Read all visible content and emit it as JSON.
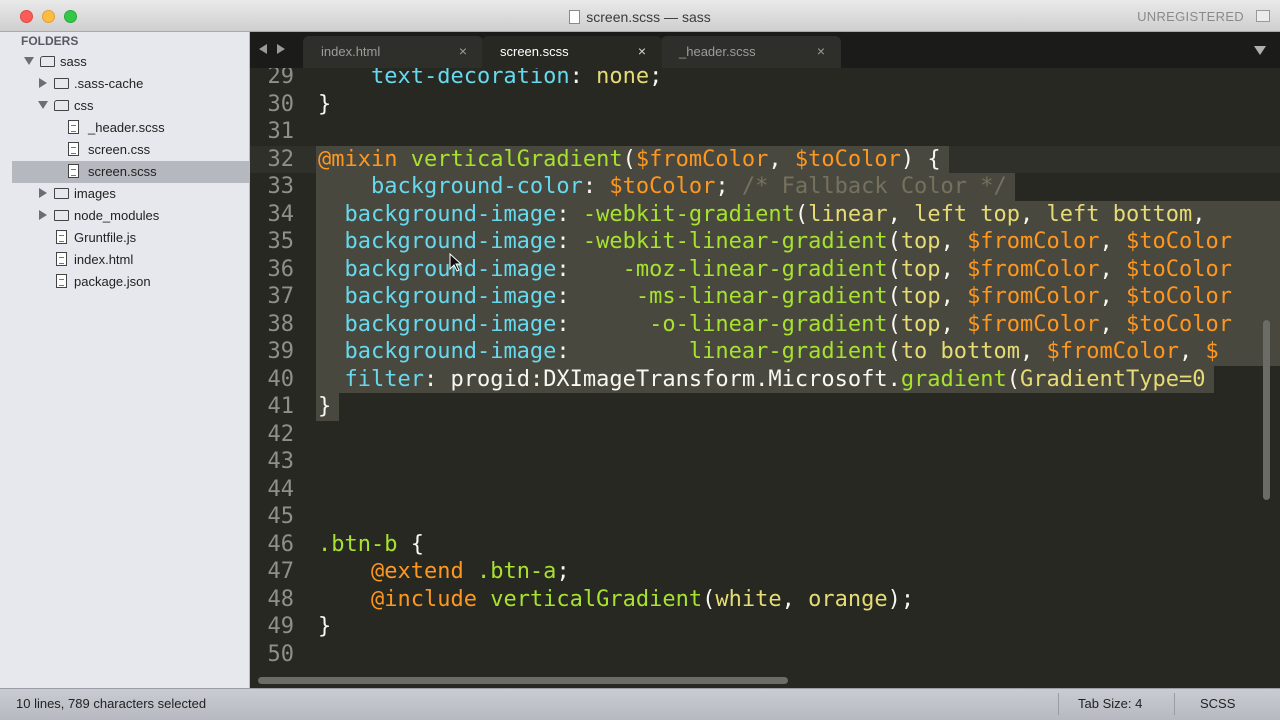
{
  "window": {
    "title": "screen.scss — sass",
    "registration": "UNREGISTERED"
  },
  "sidebar": {
    "header": "FOLDERS",
    "items": [
      {
        "label": "sass",
        "type": "folder",
        "expanded": true,
        "depth": 0
      },
      {
        "label": ".sass-cache",
        "type": "folder",
        "expanded": false,
        "depth": 1
      },
      {
        "label": "css",
        "type": "folder",
        "expanded": true,
        "depth": 1
      },
      {
        "label": "_header.scss",
        "type": "file",
        "depth": 2
      },
      {
        "label": "screen.css",
        "type": "file",
        "depth": 2
      },
      {
        "label": "screen.scss",
        "type": "file",
        "depth": 2,
        "selected": true
      },
      {
        "label": "images",
        "type": "folder",
        "expanded": false,
        "depth": 1
      },
      {
        "label": "node_modules",
        "type": "folder",
        "expanded": false,
        "depth": 1
      },
      {
        "label": "Gruntfile.js",
        "type": "file",
        "depth": 1
      },
      {
        "label": "index.html",
        "type": "file",
        "depth": 1
      },
      {
        "label": "package.json",
        "type": "file",
        "depth": 1
      }
    ]
  },
  "tabs": [
    {
      "label": "index.html",
      "close": "×",
      "active": false
    },
    {
      "label": "screen.scss",
      "close": "×",
      "active": true
    },
    {
      "label": "_header.scss",
      "close": "×",
      "active": false
    }
  ],
  "editor": {
    "lines": [
      {
        "n": "29",
        "tokens": [
          [
            "plain",
            "    "
          ],
          [
            "prop",
            "text-decoration"
          ],
          [
            "plain",
            ": "
          ],
          [
            "val",
            "none"
          ],
          [
            "plain",
            ";"
          ]
        ]
      },
      {
        "n": "30",
        "tokens": [
          [
            "plain",
            "}"
          ]
        ]
      },
      {
        "n": "31",
        "tokens": []
      },
      {
        "n": "32",
        "tokens": [
          [
            "at",
            "@mixin"
          ],
          [
            "plain",
            " "
          ],
          [
            "fn",
            "verticalGradient"
          ],
          [
            "plain",
            "("
          ],
          [
            "var",
            "$fromColor"
          ],
          [
            "plain",
            ", "
          ],
          [
            "var",
            "$toColor"
          ],
          [
            "plain",
            ") {"
          ]
        ]
      },
      {
        "n": "33",
        "tokens": [
          [
            "plain",
            "    "
          ],
          [
            "prop",
            "background-color"
          ],
          [
            "plain",
            ": "
          ],
          [
            "var",
            "$toColor"
          ],
          [
            "plain",
            "; "
          ],
          [
            "cmt",
            "/* Fallback Color */"
          ]
        ]
      },
      {
        "n": "34",
        "tokens": [
          [
            "plain",
            "  "
          ],
          [
            "prop",
            "background-image"
          ],
          [
            "plain",
            ": "
          ],
          [
            "fn",
            "-webkit-gradient"
          ],
          [
            "plain",
            "("
          ],
          [
            "val",
            "linear"
          ],
          [
            "plain",
            ", "
          ],
          [
            "val",
            "left top"
          ],
          [
            "plain",
            ", "
          ],
          [
            "val",
            "left bottom"
          ],
          [
            "plain",
            ", "
          ]
        ]
      },
      {
        "n": "35",
        "tokens": [
          [
            "plain",
            "  "
          ],
          [
            "prop",
            "background-image"
          ],
          [
            "plain",
            ": "
          ],
          [
            "fn",
            "-webkit-linear-gradient"
          ],
          [
            "plain",
            "("
          ],
          [
            "val",
            "top"
          ],
          [
            "plain",
            ", "
          ],
          [
            "var",
            "$fromColor"
          ],
          [
            "plain",
            ", "
          ],
          [
            "var",
            "$toColor"
          ]
        ]
      },
      {
        "n": "36",
        "tokens": [
          [
            "plain",
            "  "
          ],
          [
            "prop",
            "background-image"
          ],
          [
            "plain",
            ":    "
          ],
          [
            "fn",
            "-moz-linear-gradient"
          ],
          [
            "plain",
            "("
          ],
          [
            "val",
            "top"
          ],
          [
            "plain",
            ", "
          ],
          [
            "var",
            "$fromColor"
          ],
          [
            "plain",
            ", "
          ],
          [
            "var",
            "$toColor"
          ]
        ]
      },
      {
        "n": "37",
        "tokens": [
          [
            "plain",
            "  "
          ],
          [
            "prop",
            "background-image"
          ],
          [
            "plain",
            ":     "
          ],
          [
            "fn",
            "-ms-linear-gradient"
          ],
          [
            "plain",
            "("
          ],
          [
            "val",
            "top"
          ],
          [
            "plain",
            ", "
          ],
          [
            "var",
            "$fromColor"
          ],
          [
            "plain",
            ", "
          ],
          [
            "var",
            "$toColor"
          ]
        ]
      },
      {
        "n": "38",
        "tokens": [
          [
            "plain",
            "  "
          ],
          [
            "prop",
            "background-image"
          ],
          [
            "plain",
            ":      "
          ],
          [
            "fn",
            "-o-linear-gradient"
          ],
          [
            "plain",
            "("
          ],
          [
            "val",
            "top"
          ],
          [
            "plain",
            ", "
          ],
          [
            "var",
            "$fromColor"
          ],
          [
            "plain",
            ", "
          ],
          [
            "var",
            "$toColor"
          ]
        ]
      },
      {
        "n": "39",
        "tokens": [
          [
            "plain",
            "  "
          ],
          [
            "prop",
            "background-image"
          ],
          [
            "plain",
            ":         "
          ],
          [
            "fn",
            "linear-gradient"
          ],
          [
            "plain",
            "("
          ],
          [
            "val",
            "to bottom"
          ],
          [
            "plain",
            ", "
          ],
          [
            "var",
            "$fromColor"
          ],
          [
            "plain",
            ", "
          ],
          [
            "var",
            "$"
          ]
        ]
      },
      {
        "n": "40",
        "tokens": [
          [
            "plain",
            "  "
          ],
          [
            "prop",
            "filter"
          ],
          [
            "plain",
            ": progid:DXImageTransform.Microsoft."
          ],
          [
            "fn",
            "gradient"
          ],
          [
            "plain",
            "("
          ],
          [
            "val",
            "GradientType=0"
          ]
        ]
      },
      {
        "n": "41",
        "tokens": [
          [
            "plain",
            "}"
          ]
        ]
      },
      {
        "n": "42",
        "tokens": []
      },
      {
        "n": "43",
        "tokens": []
      },
      {
        "n": "44",
        "tokens": []
      },
      {
        "n": "45",
        "tokens": []
      },
      {
        "n": "46",
        "tokens": [
          [
            "cls",
            ".btn-b"
          ],
          [
            "plain",
            " {"
          ]
        ]
      },
      {
        "n": "47",
        "tokens": [
          [
            "plain",
            "    "
          ],
          [
            "at",
            "@extend"
          ],
          [
            "plain",
            " "
          ],
          [
            "cls",
            ".btn-a"
          ],
          [
            "plain",
            ";"
          ]
        ]
      },
      {
        "n": "48",
        "tokens": [
          [
            "plain",
            "    "
          ],
          [
            "at",
            "@include"
          ],
          [
            "plain",
            " "
          ],
          [
            "fn",
            "verticalGradient"
          ],
          [
            "plain",
            "("
          ],
          [
            "val",
            "white"
          ],
          [
            "plain",
            ", "
          ],
          [
            "val",
            "orange"
          ],
          [
            "plain",
            ");"
          ]
        ]
      },
      {
        "n": "49",
        "tokens": [
          [
            "plain",
            "}"
          ]
        ]
      },
      {
        "n": "50",
        "tokens": []
      }
    ]
  },
  "status": {
    "selection": "10 lines, 789 characters selected",
    "tab_size": "Tab Size: 4",
    "syntax": "SCSS"
  }
}
